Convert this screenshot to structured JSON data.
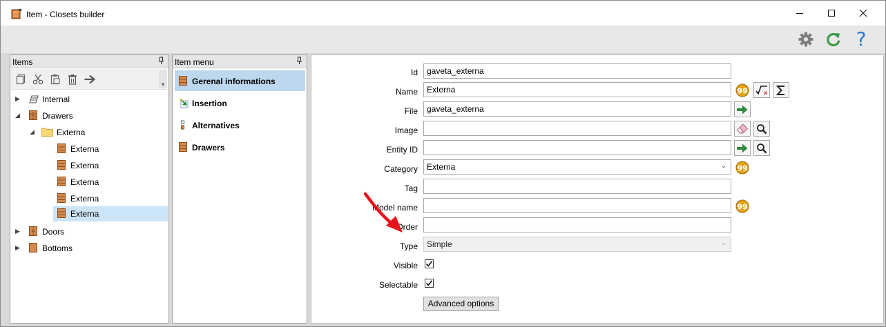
{
  "window": {
    "title": "Item - Closets builder"
  },
  "toolbar": {
    "icons": [
      "gear-icon",
      "refresh-icon",
      "help-icon"
    ],
    "accent": "#3a9a4a",
    "help_color": "#2a7bd1",
    "help_glyph": "?"
  },
  "items_panel": {
    "header": "Items",
    "pin": "ᵖ",
    "tools": [
      "copy-icon",
      "cut-icon",
      "paste-icon",
      "delete-icon",
      "move-icon"
    ],
    "tree": [
      {
        "label": "Internal",
        "level": 0,
        "expanded": false,
        "icon": "internal-icon"
      },
      {
        "label": "Drawers",
        "level": 0,
        "expanded": true,
        "icon": "drawer-icon"
      },
      {
        "label": "Externa",
        "level": 1,
        "expanded": true,
        "icon": "folder-icon"
      },
      {
        "label": "Externa",
        "level": 2,
        "icon": "drawer-icon"
      },
      {
        "label": "Externa",
        "level": 2,
        "icon": "drawer-icon"
      },
      {
        "label": "Externa",
        "level": 2,
        "icon": "drawer-icon"
      },
      {
        "label": "Externa",
        "level": 2,
        "icon": "drawer-icon"
      },
      {
        "label": "Externa",
        "level": 2,
        "icon": "drawer-icon",
        "selected": true
      },
      {
        "label": "Doors",
        "level": 0,
        "expanded": false,
        "icon": "door-icon"
      },
      {
        "label": "Bottoms",
        "level": 0,
        "expanded": false,
        "icon": "bottom-icon"
      }
    ]
  },
  "menu_panel": {
    "header": "Item menu",
    "pin": "ᵖ",
    "items": [
      {
        "label": "Gerenal informations",
        "icon": "drawer-icon",
        "selected": true
      },
      {
        "label": "Insertion",
        "icon": "insertion-icon"
      },
      {
        "label": "Alternatives",
        "icon": "alternatives-icon"
      },
      {
        "label": "Drawers",
        "icon": "drawer-icon"
      }
    ]
  },
  "form": {
    "id": {
      "label": "Id",
      "value": "gaveta_externa"
    },
    "name": {
      "label": "Name",
      "value": "Externa"
    },
    "file": {
      "label": "File",
      "value": "gaveta_externa"
    },
    "image": {
      "label": "Image",
      "value": ""
    },
    "entity_id": {
      "label": "Entity ID",
      "value": ""
    },
    "category": {
      "label": "Category",
      "value": "Externa"
    },
    "tag": {
      "label": "Tag",
      "value": ""
    },
    "model_name": {
      "label": "Model name",
      "value": ""
    },
    "order": {
      "label": "Order",
      "value": ""
    },
    "type": {
      "label": "Type",
      "value": "Simple"
    },
    "visible": {
      "label": "Visible",
      "checked": true
    },
    "selectable": {
      "label": "Selectable",
      "checked": true
    },
    "advanced_button": "Advanced options"
  },
  "annotation": {
    "arrow_color": "#e8141b"
  }
}
